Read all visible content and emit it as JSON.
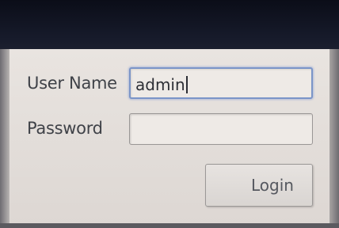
{
  "login_form": {
    "username_label": "User Name",
    "username_value": "admin",
    "password_label": "Password",
    "password_value": "",
    "login_button_label": "Login"
  },
  "colors": {
    "screen_background": "#e6e1dd",
    "focus_border": "#7b95c8",
    "text": "#3f4248"
  }
}
